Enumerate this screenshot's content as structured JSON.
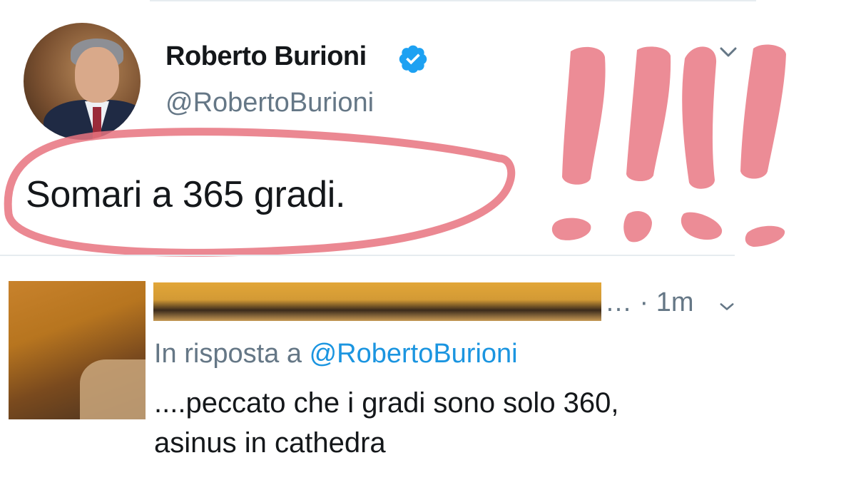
{
  "tweet": {
    "author_name": "Roberto Burioni",
    "author_handle": "@RobertoBurioni",
    "verified": true,
    "text": "Somari a 365 gradi.",
    "icons": [
      "verified-badge-icon",
      "chevron-down-icon"
    ]
  },
  "reply": {
    "timestamp": "… · 1m",
    "in_reply_prefix": "In risposta a",
    "in_reply_mention": "@RobertoBurioni",
    "text_line1": "....peccato che i gradi sono solo 360,",
    "text_line2": "asinus in cathedra"
  },
  "annotation": {
    "mark_color": "#e8737f",
    "exclamation_count": 4
  },
  "colors": {
    "text": "#14171a",
    "secondary": "#657786",
    "link": "#1b95e0",
    "verified": "#1da1f2"
  }
}
